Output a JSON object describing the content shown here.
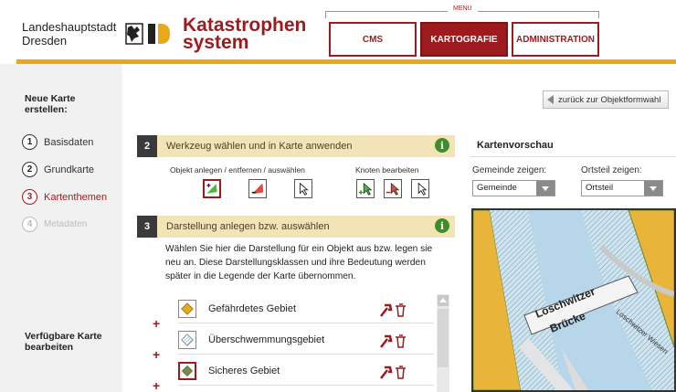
{
  "header": {
    "city_line1": "Landeshauptstadt",
    "city_line2": "Dresden",
    "brand_line1": "Katastrophen",
    "brand_line2": "system",
    "menu_label": "MENU",
    "menu": [
      {
        "label": "CMS",
        "active": false
      },
      {
        "label": "KARTOGRAFIE",
        "active": true
      },
      {
        "label": "ADMINISTRATION",
        "active": false
      }
    ],
    "colors": {
      "brand": "#9d1b1e",
      "accent": "#e8a818"
    }
  },
  "sidebar": {
    "title_line1": "Neue Karte",
    "title_line2": "erstellen:",
    "steps": [
      {
        "num": "1",
        "label": "Basisdaten",
        "state": "done"
      },
      {
        "num": "2",
        "label": "Grundkarte",
        "state": "done"
      },
      {
        "num": "3",
        "label": "Kartenthemen",
        "state": "active"
      },
      {
        "num": "4",
        "label": "Metadaten",
        "state": "disabled"
      }
    ],
    "bottom_line1": "Verfügbare Karte",
    "bottom_line2": "bearbeiten"
  },
  "back_button": {
    "label": "zurück zur Objektformwahl",
    "icon": "arrow-left-icon"
  },
  "panel2": {
    "num": "2",
    "title": "Werkzeug wählen und in Karte anwenden",
    "group1_label": "Objekt anlegen / entfernen / auswählen",
    "group2_label": "Knoten bearbeiten",
    "info_icon": "i"
  },
  "panel3": {
    "num": "3",
    "title": "Darstellung anlegen bzw. auswählen",
    "info_icon": "i",
    "description": "Wählen Sie hier die Darstellung für ein Objekt aus bzw. legen sie neu an. Diese Darstellungsklassen und ihre Bedeutung werden später in die Legende der Karte übernommen.",
    "items": [
      {
        "label": "Gefährdetes Gebiet",
        "symbol": "orange-diamond-icon"
      },
      {
        "label": "Überschwemmungsgebiet",
        "symbol": "hatched-diamond-icon"
      },
      {
        "label": "Sicheres Gebiet",
        "symbol": "green-diamond-icon"
      }
    ],
    "add_symbol": "+"
  },
  "preview": {
    "title": "Kartenvorschau",
    "gemeinde_label": "Gemeinde zeigen:",
    "gemeinde_value": "Gemeinde",
    "ortsteil_label": "Ortsteil zeigen:",
    "ortsteil_value": "Ortsteil",
    "map_label_1": "Loschwitzer",
    "map_label_2": "Brücke",
    "map_label_3": "Loschwitzer Wiesen"
  }
}
